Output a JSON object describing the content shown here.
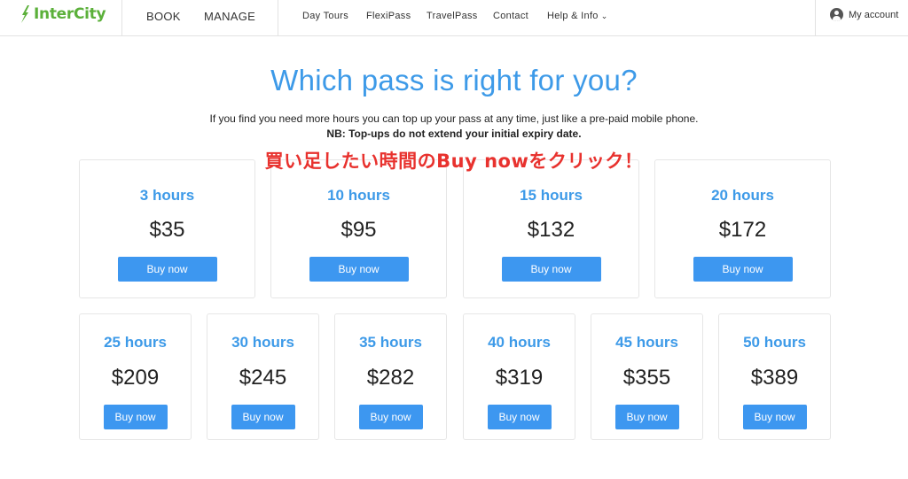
{
  "header": {
    "logo_text": "InterCity",
    "main_nav": [
      "BOOK",
      "MANAGE"
    ],
    "sub_nav": [
      "Day Tours",
      "FlexiPass",
      "TravelPass",
      "Contact"
    ],
    "help_label": "Help & Info",
    "account_label": "My account"
  },
  "main": {
    "title": "Which pass is right for you?",
    "intro_line1": "If you find you need more hours you can top up your pass at any time, just like a pre-paid mobile phone.",
    "intro_line2": "NB: Top-ups do not extend your initial expiry date.",
    "annotation": "買い足したい時間のBuy nowをクリック！"
  },
  "passes_row1": [
    {
      "hours": "3 hours",
      "price": "$35",
      "button": "Buy now"
    },
    {
      "hours": "10 hours",
      "price": "$95",
      "button": "Buy now"
    },
    {
      "hours": "15 hours",
      "price": "$132",
      "button": "Buy now"
    },
    {
      "hours": "20 hours",
      "price": "$172",
      "button": "Buy now"
    }
  ],
  "passes_row2": [
    {
      "hours": "25 hours",
      "price": "$209",
      "button": "Buy now"
    },
    {
      "hours": "30 hours",
      "price": "$245",
      "button": "Buy now"
    },
    {
      "hours": "35 hours",
      "price": "$282",
      "button": "Buy now"
    },
    {
      "hours": "40 hours",
      "price": "$319",
      "button": "Buy now"
    },
    {
      "hours": "45 hours",
      "price": "$355",
      "button": "Buy now"
    },
    {
      "hours": "50 hours",
      "price": "$389",
      "button": "Buy now"
    }
  ],
  "colors": {
    "accent": "#3d9ae8",
    "button": "#3d97f0",
    "annotation": "#e8322e",
    "logo": "#5bb03a"
  }
}
